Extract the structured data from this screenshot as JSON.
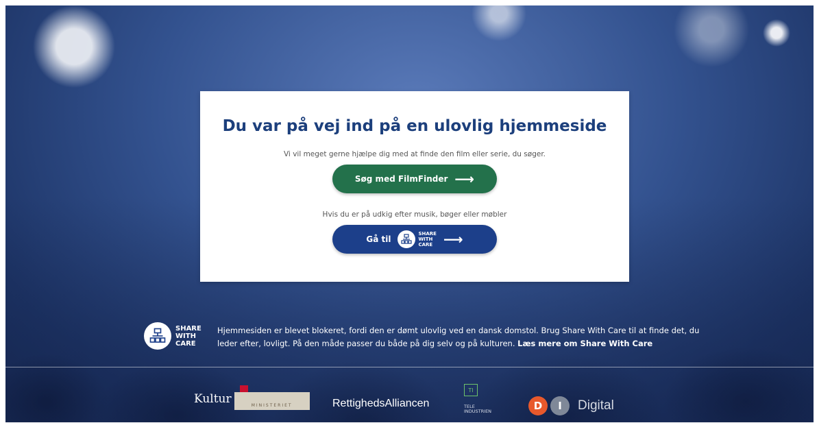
{
  "card": {
    "title": "Du var på vej ind på en ulovlig hjemmeside",
    "subtitle": "Vi vil meget gerne hjælpe dig med at finde den film eller serie, du søger.",
    "filmfinder_button": "Søg med FilmFinder",
    "alt_text": "Hvis du er på udkig efter musik, bøger eller møbler",
    "share_button_prefix": "Gå til",
    "share_logo_words": [
      "SHARE",
      "WITH",
      "CARE"
    ]
  },
  "footer": {
    "logo_words": [
      "SHARE",
      "WITH",
      "CARE"
    ],
    "info_text": "Hjemmesiden er blevet blokeret, fordi den er dømt ulovlig ved en dansk domstol. Brug Share With Care til at finde det, du leder efter, lovligt. På den måde passer du både på dig selv og på kulturen.",
    "info_link": "Læs mere om Share With Care"
  },
  "partners": {
    "kultur_script": "Kultur",
    "kultur_sub": "MINISTERIET",
    "rettigheds": "RettighedsAlliancen",
    "ti_badge": "TI",
    "ti_text_1": "TELE",
    "ti_text_2": "INDUSTRIEN",
    "di_d": "D",
    "di_i": "I",
    "di_label": "Digital"
  },
  "icons": {
    "arrow": "right-arrow-icon",
    "share_logo": "network-tree-icon"
  },
  "colors": {
    "title": "#1c3f7c",
    "filmfinder_button": "#23714b",
    "share_button": "#1c3f8a",
    "ti_green": "#6ec36a",
    "di_orange": "#e8592c"
  }
}
